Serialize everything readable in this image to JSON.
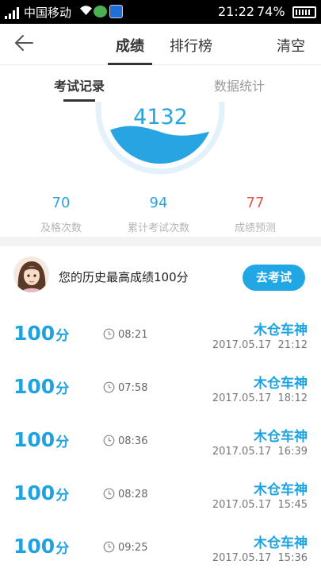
{
  "status_bar": {
    "carrier": "中国移动",
    "time": "21:22",
    "battery": "74%"
  },
  "nav": {
    "tabs": [
      {
        "label": "成绩",
        "active": true
      },
      {
        "label": "排行榜",
        "active": false
      }
    ],
    "clear_label": "清空"
  },
  "subtabs": [
    {
      "label": "考试记录",
      "active": true
    },
    {
      "label": "数据统计",
      "active": false
    }
  ],
  "gauge": {
    "score": "4132"
  },
  "stats": [
    {
      "value": "70",
      "label": "及格次数",
      "color": "#29a4e2"
    },
    {
      "value": "94",
      "label": "累计考试次数",
      "color": "#29a4e2"
    },
    {
      "value": "77",
      "label": "成绩预测",
      "color": "#e05a4a"
    }
  ],
  "best": {
    "text": "您的历史最高成绩100分",
    "button_label": "去考试"
  },
  "records": [
    {
      "score": "100",
      "unit": "分",
      "duration": "08:21",
      "name": "木仓车神",
      "date": "2017.05.17  21:12"
    },
    {
      "score": "100",
      "unit": "分",
      "duration": "07:58",
      "name": "木仓车神",
      "date": "2017.05.17  18:12"
    },
    {
      "score": "100",
      "unit": "分",
      "duration": "08:36",
      "name": "木仓车神",
      "date": "2017.05.17  16:39"
    },
    {
      "score": "100",
      "unit": "分",
      "duration": "08:28",
      "name": "木仓车神",
      "date": "2017.05.17  15:45"
    },
    {
      "score": "100",
      "unit": "分",
      "duration": "09:25",
      "name": "木仓车神",
      "date": "2017.05.17  15:36"
    }
  ],
  "colors": {
    "accent": "#21a7e4",
    "record_blue": "#1fa3e0",
    "predict_red": "#e05a4a"
  }
}
